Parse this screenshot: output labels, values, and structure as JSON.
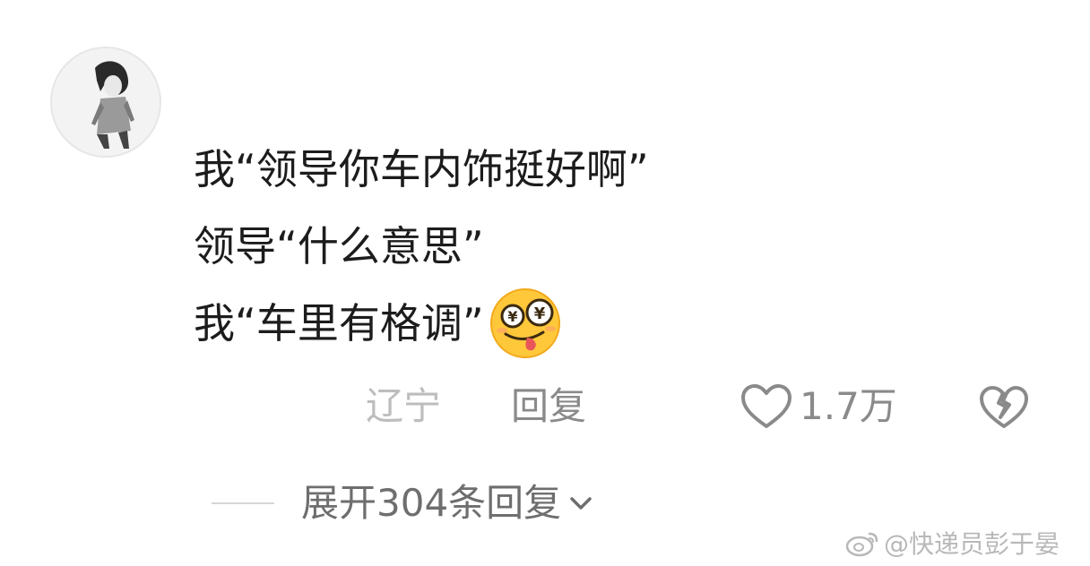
{
  "comment": {
    "lines": [
      "我“领导你车内饰挺好啊”",
      "领导“什么意思”",
      "我“车里有格调”"
    ],
    "emoji": "money-eyes-tongue-emoji"
  },
  "meta": {
    "location": "辽宁",
    "reply_label": "回复",
    "like_count": "1.7万"
  },
  "expand": {
    "label": "展开304条回复"
  },
  "watermark": {
    "text": "@快递员彭于晏"
  },
  "icons": {
    "like": "heart-outline-icon",
    "dislike": "broken-heart-icon",
    "expand": "chevron-down-icon",
    "watermark": "weibo-logo-icon"
  },
  "colors": {
    "text_primary": "#1c1c1c",
    "text_secondary": "#8a8a8a",
    "text_muted": "#bdbdbd",
    "emoji_face": "#ffc83a"
  }
}
